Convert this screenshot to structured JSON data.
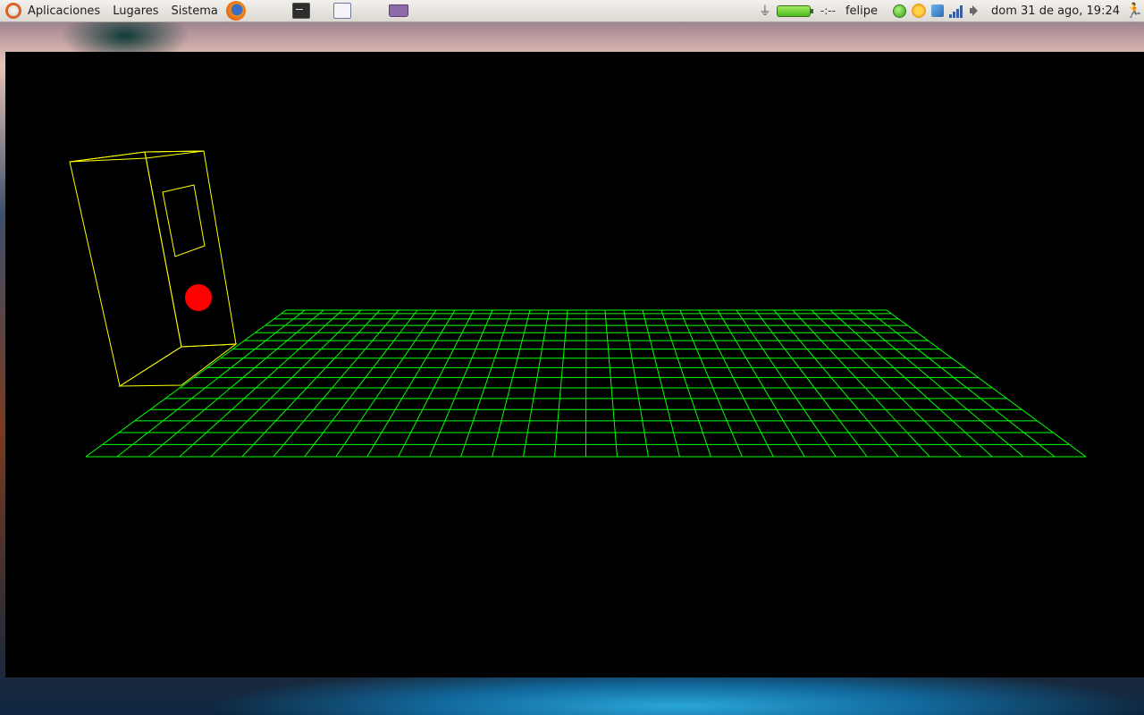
{
  "top_panel": {
    "menus": [
      "Aplicaciones",
      "Lugares",
      "Sistema"
    ],
    "launchers": [
      "firefox-icon",
      "terminal-icon",
      "text-editor-icon",
      "package-icon"
    ],
    "battery_time": "-:--",
    "user": "felipe",
    "datetime": "dom 31 de ago, 19:24"
  },
  "scene": {
    "floor_grid": {
      "color": "#00ff00",
      "rows": 16,
      "columns": 32
    },
    "wireframe_object": {
      "color": "#ffff00"
    },
    "ball": {
      "color": "#ff0000"
    }
  },
  "colors": {
    "panel_background": "#dcd8d2",
    "window_background": "#000000",
    "grid": "#00ff00",
    "box": "#ffff00",
    "ball": "#ff0000"
  }
}
